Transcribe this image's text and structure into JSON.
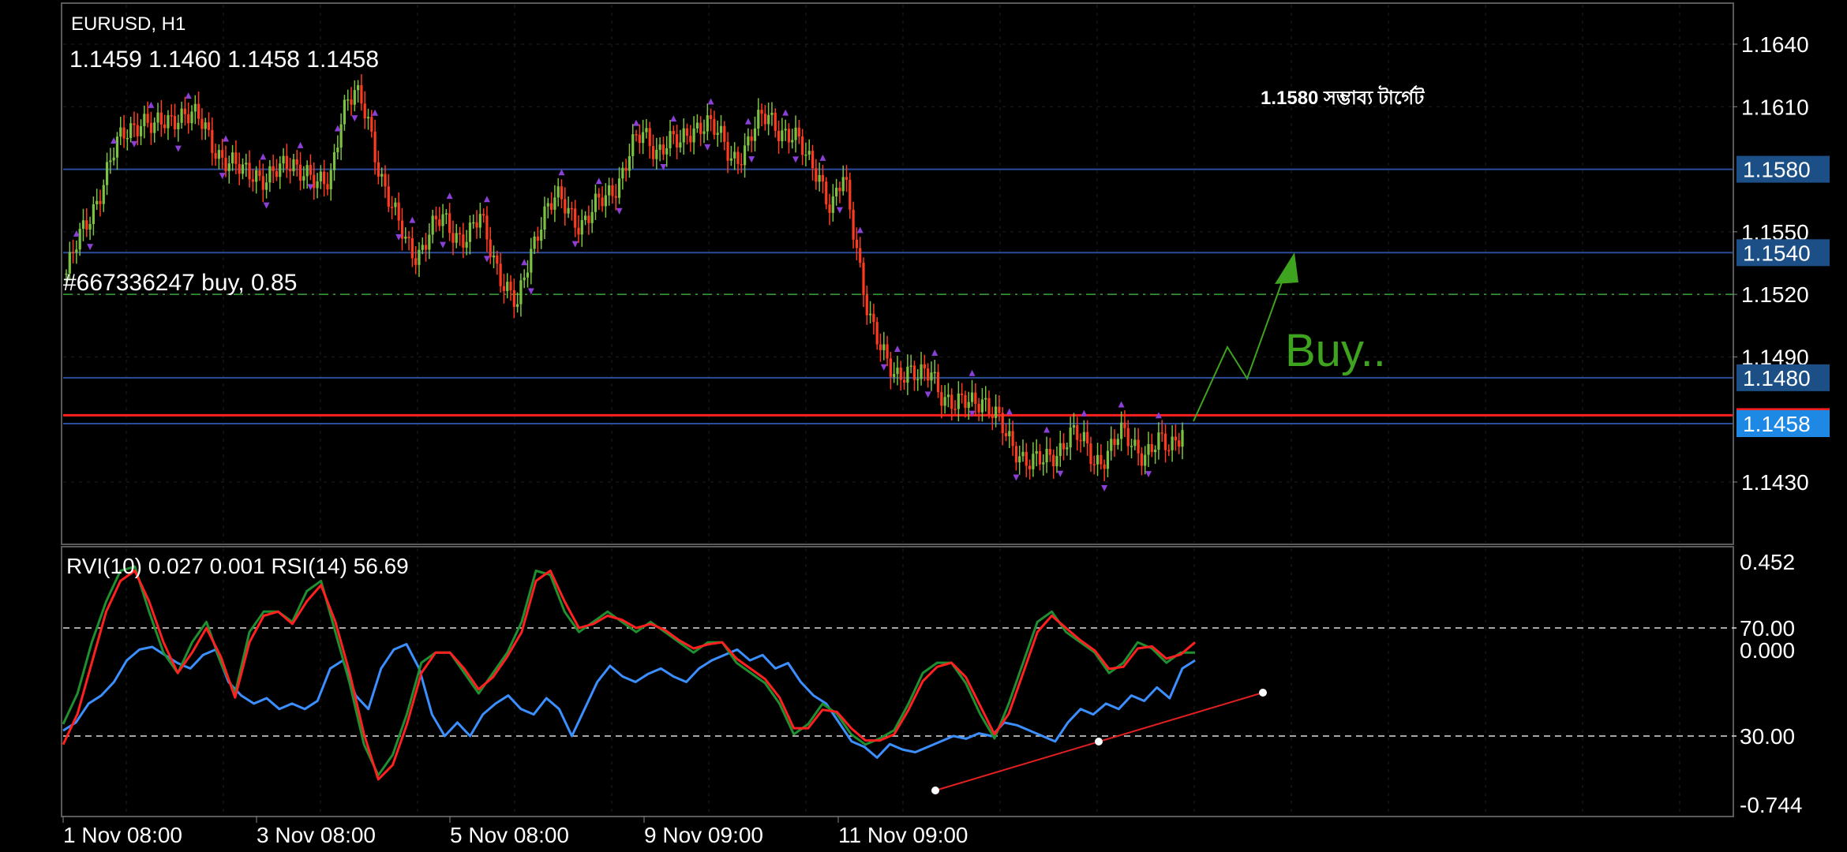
{
  "colors": {
    "background": "#000000",
    "frame": "#5a5a5a",
    "grid": "#1f1f1f",
    "bull": "#7cc242",
    "bear": "#ff3b1f",
    "level": "#2b4d99",
    "level_label_bg": "#1c4f86",
    "current_label_bg": "#1e88e5",
    "red_line": "#ff2020",
    "trade_line": "#3aa63a",
    "arrow": "#3ea31e",
    "fractal": "#8a3fd6",
    "rvi_main": "#1f8f2f",
    "rvi_signal": "#ff2020",
    "rsi": "#3b8fff"
  },
  "header": {
    "symbol_timeframe": "EURUSD, H1",
    "ohlc": "1.1459 1.1460 1.1458 1.1458",
    "order_label": "#667336247 buy, 0.85",
    "target_label": "1.1580  সম্ভাব্য  টার্গেট",
    "buy_text": "Buy.."
  },
  "indicator_header": "RVI(10) 0.027 0.001 RSI(14) 56.69",
  "chart_data": {
    "type": "candlestick",
    "symbol": "EURUSD",
    "timeframe": "H1",
    "price_axis": {
      "ticks": [
        "1.1640",
        "1.1610",
        "1.1550",
        "1.1520",
        "1.1490",
        "1.1430"
      ],
      "range": [
        1.14,
        1.1665
      ]
    },
    "x_tick_labels": [
      "1 Nov 08:00",
      "3 Nov 08:00",
      "5 Nov 08:00",
      "9 Nov 09:00",
      "11 Nov 09:00"
    ],
    "horizontal_levels": [
      1.158,
      1.154,
      1.148,
      1.1458
    ],
    "level_labels": [
      "1.1580",
      "1.1540",
      "1.1480",
      "1.1458"
    ],
    "red_level": 1.1462,
    "trade_level": 1.152,
    "close_path": [
      1.153,
      1.1545,
      1.156,
      1.1575,
      1.159,
      1.16,
      1.1605,
      1.1598,
      1.1603,
      1.1608,
      1.1605,
      1.16,
      1.159,
      1.1582,
      1.1578,
      1.158,
      1.1575,
      1.1578,
      1.1585,
      1.158,
      1.157,
      1.1575,
      1.161,
      1.1615,
      1.1605,
      1.158,
      1.156,
      1.1545,
      1.154,
      1.155,
      1.1555,
      1.155,
      1.1548,
      1.1555,
      1.154,
      1.1525,
      1.1512,
      1.154,
      1.156,
      1.1565,
      1.156,
      1.1555,
      1.156,
      1.1565,
      1.1575,
      1.159,
      1.1595,
      1.159,
      1.1595,
      1.159,
      1.16,
      1.1605,
      1.1595,
      1.1585,
      1.159,
      1.16,
      1.1605,
      1.16,
      1.1595,
      1.1585,
      1.158,
      1.156,
      1.1575,
      1.1545,
      1.151,
      1.149,
      1.1483,
      1.1485,
      1.1478,
      1.1483,
      1.1472,
      1.1465,
      1.1468,
      1.1472,
      1.1462,
      1.145,
      1.1445,
      1.144,
      1.1438,
      1.1445,
      1.1455,
      1.1448,
      1.144,
      1.1445,
      1.1452,
      1.1448,
      1.1445,
      1.1448,
      1.1445,
      1.1458
    ],
    "rvi_panel": {
      "y_ticks": [
        "0.452",
        "70.00",
        "0.000",
        "30.00",
        "-0.744"
      ],
      "levels": [
        70,
        30
      ],
      "rsi": [
        32,
        35,
        42,
        45,
        50,
        58,
        62,
        63,
        60,
        57,
        55,
        60,
        62,
        50,
        45,
        42,
        44,
        40,
        42,
        40,
        43,
        55,
        58,
        45,
        40,
        55,
        62,
        64,
        55,
        38,
        30,
        35,
        30,
        38,
        42,
        45,
        40,
        38,
        44,
        40,
        30,
        40,
        50,
        56,
        52,
        50,
        53,
        55,
        52,
        50,
        55,
        58,
        60,
        62,
        58,
        60,
        55,
        57,
        50,
        45,
        42,
        35,
        28,
        26,
        22,
        27,
        25,
        24,
        26,
        28,
        30,
        29,
        31,
        30,
        35,
        34,
        32,
        30,
        28,
        35,
        40,
        38,
        42,
        40,
        45,
        43,
        48,
        44,
        55,
        58
      ],
      "rvi_main": [
        -0.35,
        -0.2,
        0.05,
        0.25,
        0.4,
        0.42,
        0.2,
        0.0,
        -0.1,
        0.05,
        0.15,
        -0.05,
        -0.2,
        0.1,
        0.2,
        0.2,
        0.15,
        0.3,
        0.35,
        0.1,
        -0.15,
        -0.45,
        -0.6,
        -0.5,
        -0.3,
        -0.05,
        0.0,
        0.0,
        -0.1,
        -0.2,
        -0.1,
        0.0,
        0.15,
        0.4,
        0.38,
        0.2,
        0.1,
        0.15,
        0.2,
        0.15,
        0.1,
        0.15,
        0.1,
        0.05,
        0.0,
        0.05,
        0.05,
        -0.05,
        -0.1,
        -0.15,
        -0.25,
        -0.4,
        -0.35,
        -0.25,
        -0.3,
        -0.4,
        -0.45,
        -0.42,
        -0.38,
        -0.25,
        -0.1,
        -0.05,
        -0.05,
        -0.15,
        -0.3,
        -0.42,
        -0.25,
        -0.05,
        0.15,
        0.2,
        0.1,
        0.05,
        0.0,
        -0.1,
        -0.05,
        0.05,
        0.02,
        -0.05,
        0.0,
        0.0
      ],
      "rvi_signal": [
        -0.45,
        -0.3,
        -0.05,
        0.2,
        0.35,
        0.4,
        0.25,
        0.05,
        -0.1,
        0.0,
        0.12,
        -0.02,
        -0.22,
        0.05,
        0.18,
        0.2,
        0.14,
        0.25,
        0.33,
        0.15,
        -0.1,
        -0.4,
        -0.62,
        -0.55,
        -0.35,
        -0.1,
        0.0,
        0.0,
        -0.08,
        -0.18,
        -0.12,
        -0.02,
        0.1,
        0.35,
        0.4,
        0.25,
        0.12,
        0.14,
        0.18,
        0.16,
        0.12,
        0.14,
        0.11,
        0.06,
        0.02,
        0.04,
        0.05,
        -0.03,
        -0.08,
        -0.13,
        -0.22,
        -0.37,
        -0.37,
        -0.28,
        -0.29,
        -0.37,
        -0.43,
        -0.43,
        -0.4,
        -0.28,
        -0.14,
        -0.07,
        -0.05,
        -0.12,
        -0.26,
        -0.4,
        -0.3,
        -0.1,
        0.1,
        0.18,
        0.12,
        0.06,
        0.01,
        -0.08,
        -0.07,
        0.02,
        0.03,
        -0.03,
        -0.01,
        0.05
      ]
    }
  }
}
